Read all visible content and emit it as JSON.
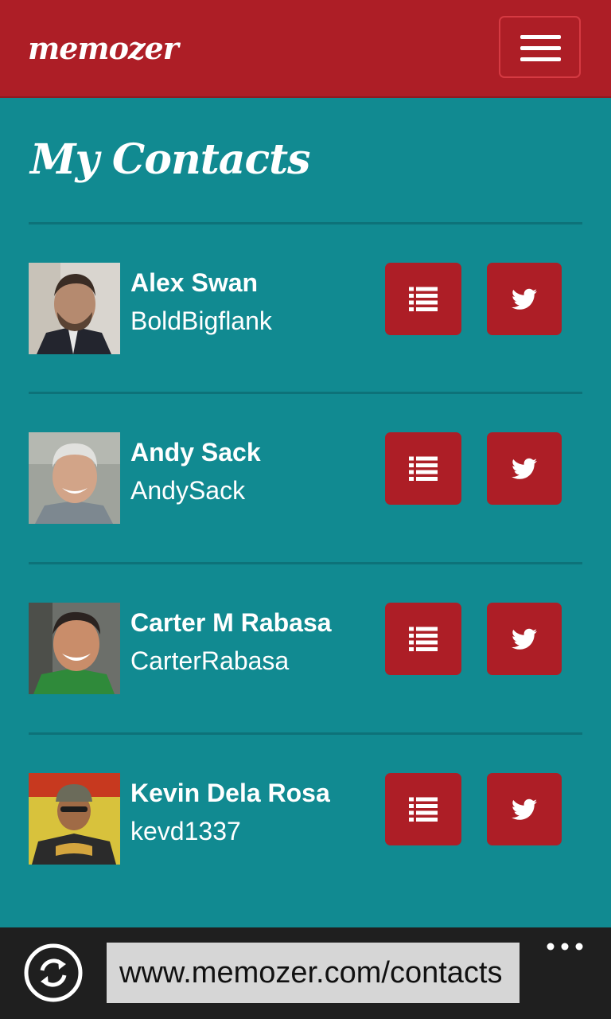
{
  "navbar": {
    "brand": "memozer",
    "menu_icon": "hamburger-icon"
  },
  "page": {
    "title": "My Contacts"
  },
  "contacts": [
    {
      "name": "Alex Swan",
      "handle": "BoldBigflank"
    },
    {
      "name": "Andy Sack",
      "handle": "AndySack"
    },
    {
      "name": "Carter M Rabasa",
      "handle": "CarterRabasa"
    },
    {
      "name": "Kevin Dela Rosa",
      "handle": "kevd1337"
    }
  ],
  "actions": {
    "list_icon": "list-icon",
    "twitter_icon": "twitter-bird-icon"
  },
  "browser": {
    "url": "www.memozer.com/contacts",
    "refresh_icon": "refresh-icon",
    "more_icon": "more-ellipsis-icon"
  },
  "colors": {
    "primary": "#ad1e26",
    "background": "#118a91",
    "divider": "#0d7279",
    "appbar": "#1f1f1f",
    "address_bar": "#d6d6d6"
  }
}
